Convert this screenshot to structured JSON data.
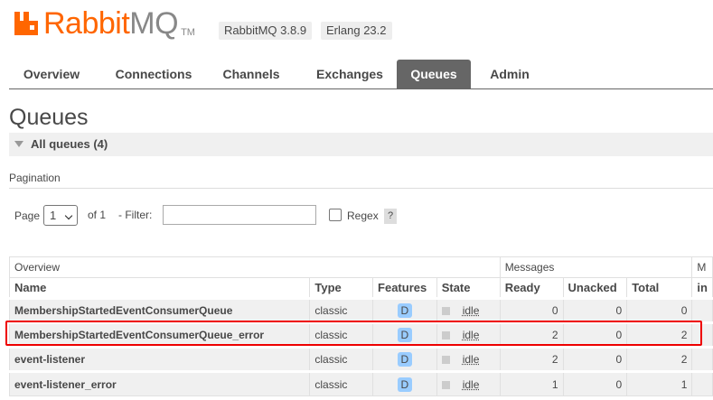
{
  "header": {
    "logo_rabbit": "Rabbit",
    "logo_mq": "MQ",
    "logo_tm": "TM",
    "versions": [
      "RabbitMQ 3.8.9",
      "Erlang 23.2"
    ]
  },
  "nav": {
    "tabs": [
      "Overview",
      "Connections",
      "Channels",
      "Exchanges",
      "Queues",
      "Admin"
    ],
    "active": "Queues"
  },
  "page": {
    "title": "Queues",
    "section": "All queues (4)"
  },
  "pagination": {
    "label": "Pagination",
    "page_label": "Page",
    "page_value": "1",
    "of_label": "of 1",
    "filter_label": "- Filter:",
    "filter_value": "",
    "regex_label": "Regex",
    "help": "?"
  },
  "table": {
    "groups": {
      "overview": "Overview",
      "messages": "Messages",
      "rates": "M"
    },
    "columns": [
      "Name",
      "Type",
      "Features",
      "State",
      "Ready",
      "Unacked",
      "Total",
      "in"
    ],
    "rows": [
      {
        "name": "MembershipStartedEventConsumerQueue",
        "type": "classic",
        "feature": "D",
        "state": "idle",
        "ready": "0",
        "unacked": "0",
        "total": "0"
      },
      {
        "name": "MembershipStartedEventConsumerQueue_error",
        "type": "classic",
        "feature": "D",
        "state": "idle",
        "ready": "2",
        "unacked": "0",
        "total": "2"
      },
      {
        "name": "event-listener",
        "type": "classic",
        "feature": "D",
        "state": "idle",
        "ready": "2",
        "unacked": "0",
        "total": "2"
      },
      {
        "name": "event-listener_error",
        "type": "classic",
        "feature": "D",
        "state": "idle",
        "ready": "1",
        "unacked": "0",
        "total": "1"
      }
    ]
  },
  "colors": {
    "brand": "#ff6600",
    "highlight": "#e00000",
    "feature_badge": "#99ccff"
  }
}
